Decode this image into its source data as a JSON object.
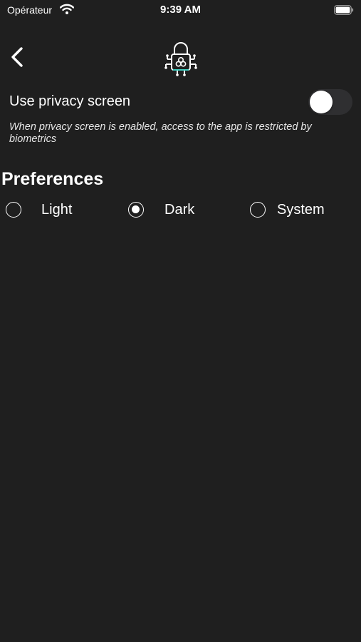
{
  "status_bar": {
    "carrier": "Opérateur",
    "time": "9:39 AM",
    "icons": [
      "wifi-icon",
      "battery-icon"
    ]
  },
  "header": {
    "back_icon": "chevron-left-icon",
    "logo_icon": "padlock-circuit-icon"
  },
  "privacy": {
    "label": "Use privacy screen",
    "enabled": false,
    "description": "When privacy screen is enabled, access to the app is restricted by biometrics"
  },
  "preferences": {
    "title": "Preferences",
    "options": [
      {
        "label": "Light",
        "selected": false
      },
      {
        "label": "Dark",
        "selected": true
      },
      {
        "label": "System",
        "selected": false
      }
    ]
  },
  "colors": {
    "background": "#1f1f1f",
    "toggle_track": "#2f2f31",
    "logo_accent": "#3ecfc0"
  }
}
